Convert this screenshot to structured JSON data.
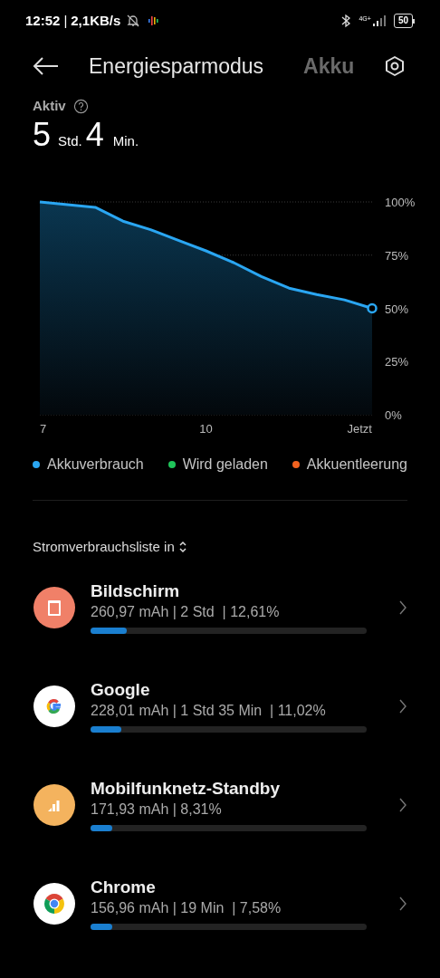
{
  "status_bar": {
    "time": "12:52",
    "separator": "|",
    "speed": "2,1KB/s",
    "network": "4G+",
    "battery": "50"
  },
  "header": {
    "tabs": [
      {
        "label": "Energiesparmodus",
        "selected": true
      },
      {
        "label": "Akku",
        "selected": false
      }
    ]
  },
  "active": {
    "label": "Aktiv",
    "hours": "5",
    "hours_unit": "Std.",
    "minutes": "4",
    "minutes_unit": "Min."
  },
  "chart_data": {
    "type": "area",
    "x": [
      7,
      7.5,
      8,
      8.5,
      9,
      9.5,
      10,
      10.5,
      11,
      11.5,
      12,
      12.5,
      13
    ],
    "series": [
      {
        "name": "Akkuverbrauch",
        "color": "#2aa6f2",
        "values": [
          100,
          98.7,
          97.5,
          91,
          87,
          82,
          77,
          71.5,
          65,
          59.5,
          56.5,
          54,
          50
        ]
      }
    ],
    "xlim": [
      7,
      13
    ],
    "ylim": [
      0,
      100
    ],
    "xticks": [
      7,
      10,
      {
        "value": 13,
        "label": "Jetzt"
      }
    ],
    "yticks": [
      {
        "value": 0,
        "label": "0%"
      },
      {
        "value": 25,
        "label": "25%"
      },
      {
        "value": 50,
        "label": "50%"
      },
      {
        "value": 75,
        "label": "75%"
      },
      {
        "value": 100,
        "label": "100%"
      }
    ]
  },
  "legend": [
    {
      "label": "Wird geladen",
      "color": "#1fc45a"
    },
    {
      "label": "Akkuentleerung",
      "color": "#f2621f"
    }
  ],
  "list_header": "Stromverbrauchsliste in",
  "items": [
    {
      "name": "Bildschirm",
      "detail": "260,97 mAh | 2 Std  | 12,61%",
      "level": 0.13
    },
    {
      "name": "Google",
      "detail": "228,01 mAh | 1 Std 35 Min  | 11,02%",
      "level": 0.11
    },
    {
      "name": "Mobilfunknetz-Standby",
      "detail": "171,93 mAh | 8,31%",
      "level": 0.08
    },
    {
      "name": "Chrome",
      "detail": "156,96 mAh | 19 Min  | 7,58%",
      "level": 0.08
    }
  ]
}
